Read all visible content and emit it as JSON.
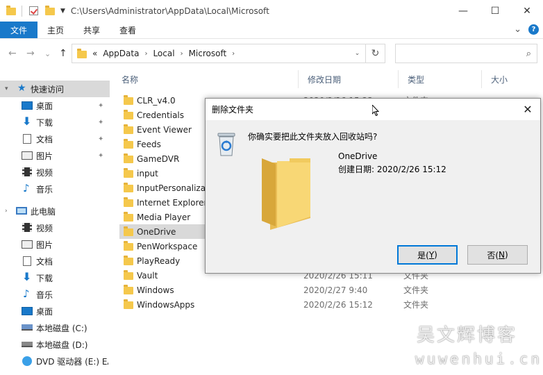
{
  "window": {
    "title_path": "C:\\Users\\Administrator\\AppData\\Local\\Microsoft",
    "minimize": "—",
    "maximize": "☐",
    "close": "✕"
  },
  "ribbon": {
    "tabs": [
      {
        "label": "文件"
      },
      {
        "label": "主页"
      },
      {
        "label": "共享"
      },
      {
        "label": "查看"
      }
    ],
    "expand": "⌄",
    "help": "?"
  },
  "nav": {
    "back": "←",
    "forward": "→",
    "recent": "⌄",
    "up": "↑"
  },
  "address": {
    "overflow": "«",
    "crumbs": [
      "AppData",
      "Local",
      "Microsoft"
    ],
    "sep": "›",
    "refresh": "↻",
    "search_icon": "⌕"
  },
  "sidebar": {
    "quick_access": "快速访问",
    "quick_items": [
      {
        "label": "桌面"
      },
      {
        "label": "下载"
      },
      {
        "label": "文档"
      },
      {
        "label": "图片"
      },
      {
        "label": "视频"
      },
      {
        "label": "音乐"
      }
    ],
    "this_pc": "此电脑",
    "pc_items": [
      {
        "label": "视频"
      },
      {
        "label": "图片"
      },
      {
        "label": "文档"
      },
      {
        "label": "下载"
      },
      {
        "label": "音乐"
      },
      {
        "label": "桌面"
      },
      {
        "label": "本地磁盘 (C:)"
      },
      {
        "label": "本地磁盘 (D:)"
      },
      {
        "label": "DVD 驱动器 (E:) EA"
      }
    ],
    "pin_glyph": "📌"
  },
  "columns": {
    "name": "名称",
    "modified": "修改日期",
    "type": "类型",
    "size": "大小"
  },
  "files": [
    {
      "name": "CLR_v4.0",
      "date": "2020/2/26 15:23",
      "type": "文件夹"
    },
    {
      "name": "Credentials",
      "date": "",
      "type": ""
    },
    {
      "name": "Event Viewer",
      "date": "",
      "type": ""
    },
    {
      "name": "Feeds",
      "date": "",
      "type": ""
    },
    {
      "name": "GameDVR",
      "date": "",
      "type": ""
    },
    {
      "name": "input",
      "date": "",
      "type": ""
    },
    {
      "name": "InputPersonalization",
      "date": "",
      "type": ""
    },
    {
      "name": "Internet Explorer",
      "date": "",
      "type": ""
    },
    {
      "name": "Media Player",
      "date": "",
      "type": ""
    },
    {
      "name": "OneDrive",
      "date": "",
      "type": ""
    },
    {
      "name": "PenWorkspace",
      "date": "",
      "type": ""
    },
    {
      "name": "PlayReady",
      "date": "",
      "type": ""
    },
    {
      "name": "Vault",
      "date": "2020/2/26 15:11",
      "type": "文件夹"
    },
    {
      "name": "Windows",
      "date": "2020/2/27 9:40",
      "type": "文件夹"
    },
    {
      "name": "WindowsApps",
      "date": "2020/2/26 15:12",
      "type": "文件夹"
    }
  ],
  "dialog": {
    "title": "删除文件夹",
    "close": "✕",
    "question": "你确实要把此文件夹放入回收站吗?",
    "item_name": "OneDrive",
    "created": "创建日期: 2020/2/26 15:12",
    "yes_label": "是(",
    "yes_key": "Y",
    "no_label": "否(",
    "no_key": "N",
    "paren_close": ")"
  },
  "watermark": {
    "line1": "吴文辉博客",
    "line2": "wuwenhui.cn"
  },
  "colors": {
    "accent": "#1979ca",
    "folder": "#f5c84c",
    "selected": "#d9d9d9",
    "dialog_bg": "#f0f0f0"
  }
}
